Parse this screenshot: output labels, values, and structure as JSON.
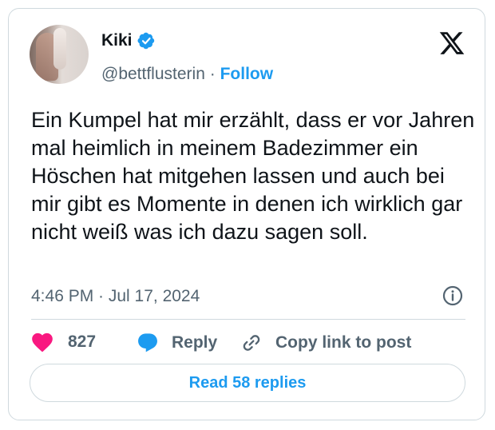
{
  "user": {
    "name": "Kiki",
    "handle": "@bettflusterin",
    "separator": "·",
    "follow_label": "Follow"
  },
  "tweet": {
    "text": "Ein Kumpel hat mir erzählt, dass er vor Jahren mal heimlich in meinem Badezimmer ein Höschen hat mitgehen lassen und auch bei mir gibt es Momente in denen ich wirklich gar nicht weiß was ich dazu sagen soll.",
    "timestamp": "4:46 PM · Jul 17, 2024"
  },
  "actions": {
    "like_count": "827",
    "reply_label": "Reply",
    "copy_label": "Copy link to post"
  },
  "footer": {
    "read_replies_label": "Read 58 replies"
  },
  "icons": {
    "verified": "verified-badge-icon",
    "logo": "x-logo-icon",
    "info": "info-icon",
    "like": "heart-icon",
    "reply": "speech-bubble-icon",
    "copy": "link-icon"
  },
  "colors": {
    "accent": "#1d9bf0",
    "like": "#f91880",
    "text": "#0f1419",
    "secondary": "#536471",
    "border": "#cfd9de"
  }
}
